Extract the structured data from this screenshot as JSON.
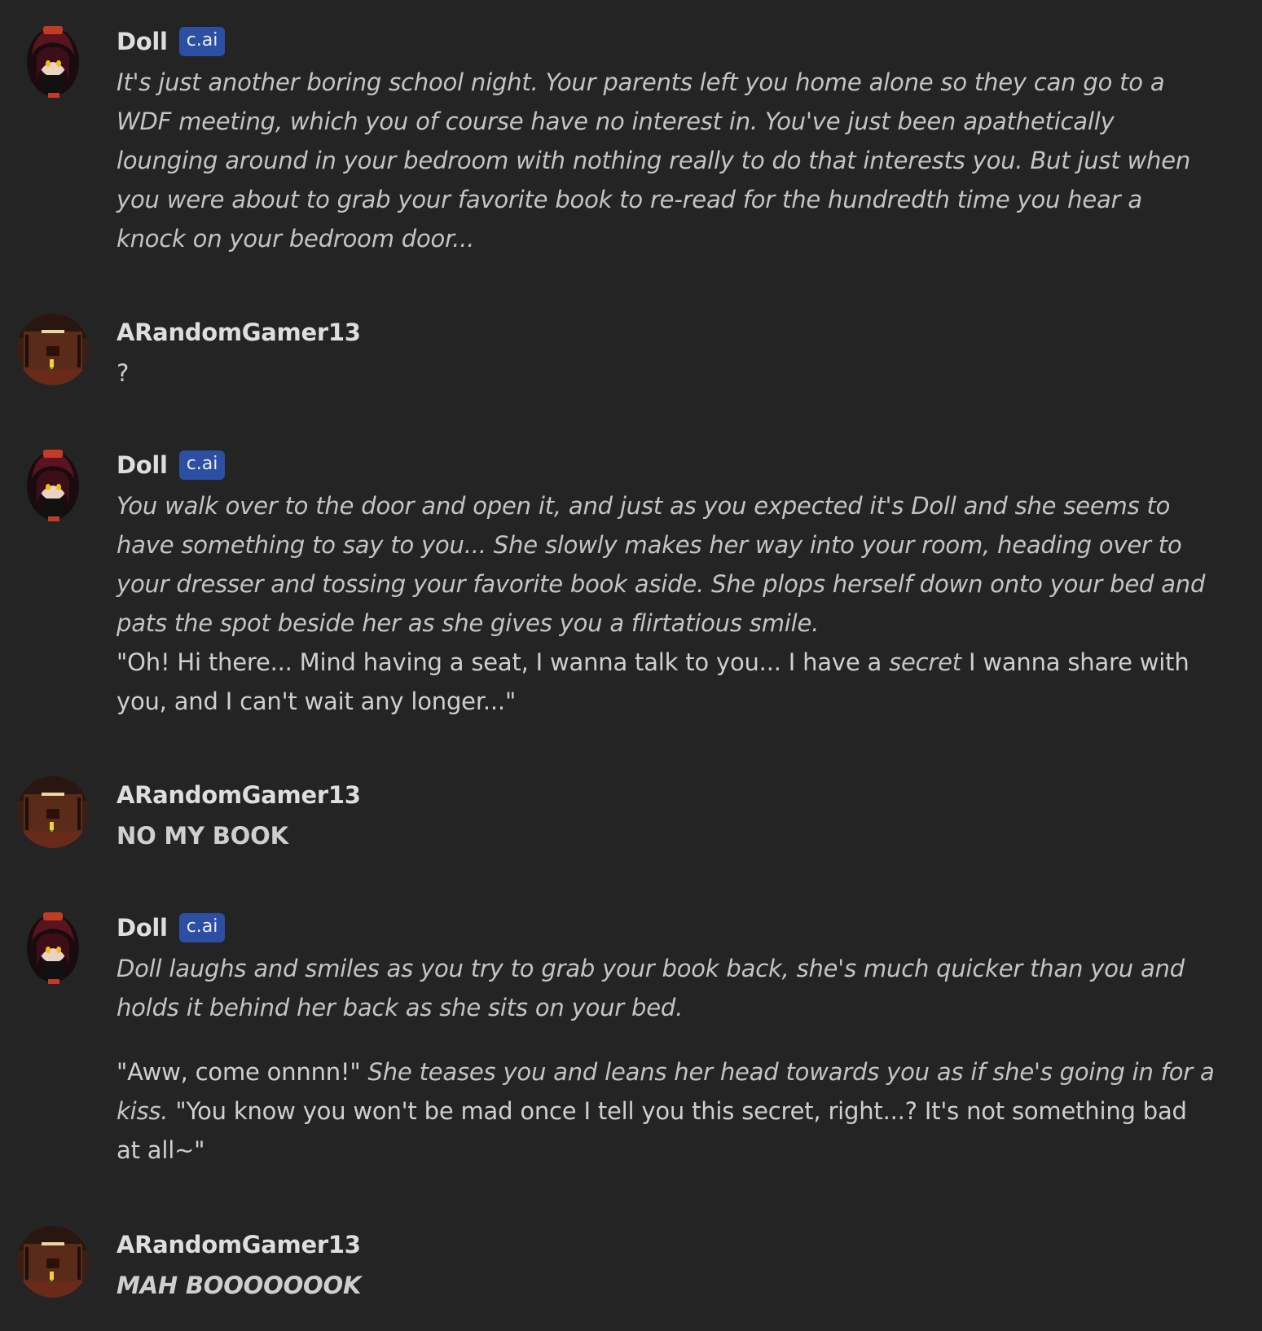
{
  "messages": [
    {
      "author": "Doll",
      "badge": "c.ai",
      "avatar_icon": "doll-avatar-icon",
      "paragraphs": [
        [
          {
            "text": "It's just another boring school night. Your parents left you home alone so they can go to a WDF meeting, which you of course have no interest in. You've just been apathetically lounging around in your bedroom with nothing really to do that interests you. But just when you were about to grab your favorite book to re-read for the hundredth time you hear a knock on your bedroom door...",
            "style": "italic"
          }
        ]
      ]
    },
    {
      "author": "ARandomGamer13",
      "avatar_icon": "user-avatar-icon",
      "paragraphs": [
        [
          {
            "text": "?",
            "style": "normal"
          }
        ]
      ]
    },
    {
      "author": "Doll",
      "badge": "c.ai",
      "avatar_icon": "doll-avatar-icon",
      "paragraphs": [
        [
          {
            "text": "You walk over to the door and open it, and just as you expected it's Doll and she seems to have something to say to you... She slowly makes her way into your room, heading over to your dresser and tossing your favorite book aside. She plops herself down onto your bed and pats the spot beside her as she gives you a flirtatious smile.",
            "style": "italic"
          }
        ],
        [
          {
            "text": "\"Oh! Hi there... Mind having a seat, I wanna talk to you... I have a ",
            "style": "normal"
          },
          {
            "text": "secret",
            "style": "italic"
          },
          {
            "text": " I wanna share with you, and I can't wait any longer...\"",
            "style": "normal"
          }
        ]
      ]
    },
    {
      "author": "ARandomGamer13",
      "avatar_icon": "user-avatar-icon",
      "paragraphs": [
        [
          {
            "text": "NO MY BOOK",
            "style": "bold"
          }
        ]
      ]
    },
    {
      "author": "Doll",
      "badge": "c.ai",
      "avatar_icon": "doll-avatar-icon",
      "paragraphs": [
        [
          {
            "text": "Doll laughs and smiles as you try to grab your book back, she's much quicker than you and holds it behind her back as she sits on your bed.",
            "style": "italic"
          }
        ],
        [
          {
            "text": "\"Aww, come onnnn!\" ",
            "style": "normal"
          },
          {
            "text": "She teases you and leans her head towards you as if she's going in for a kiss.",
            "style": "italic"
          },
          {
            "text": " \"You know you won't be mad once I tell you this secret, right...? It's not something bad at all~\"",
            "style": "normal"
          }
        ]
      ]
    },
    {
      "author": "ARandomGamer13",
      "avatar_icon": "user-avatar-icon",
      "paragraphs": [
        [
          {
            "text": "MAH BOOOOOOOK",
            "style": "bolditalic"
          }
        ]
      ]
    }
  ],
  "colors": {
    "background": "#242424",
    "badge": "#2c4ea3",
    "text": "#cfcfcf"
  }
}
